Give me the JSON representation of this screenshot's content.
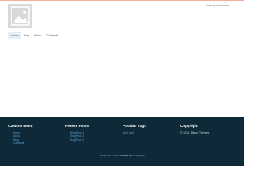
{
  "header": {
    "tagline": "Enter your html here"
  },
  "nav": {
    "items": [
      {
        "label": "Home"
      },
      {
        "label": "Blog"
      },
      {
        "label": "About"
      },
      {
        "label": "Contacts"
      }
    ]
  },
  "footer": {
    "custom_menu": {
      "title": "Custom Menu",
      "items": [
        "Home",
        "About",
        "Blog",
        "Contacts"
      ]
    },
    "recent_posts": {
      "title": "Recent Posts",
      "items": [
        "Blog Post 1",
        "Blog Post 2",
        "Blog Post 3"
      ]
    },
    "popular_tags": {
      "title": "Popular Tags",
      "tags": "tag1, tag2"
    },
    "copyright": {
      "title": "Copyright",
      "text": "© 2016, Bilson Themes"
    },
    "credits": {
      "link1": "WordPress Theme",
      "middle": "created with",
      "link2": "Pinegrow"
    }
  },
  "colors": {
    "footer_bg": "#0e2a38",
    "accent": "#2e6da4",
    "top_border": "#f0b39a"
  }
}
